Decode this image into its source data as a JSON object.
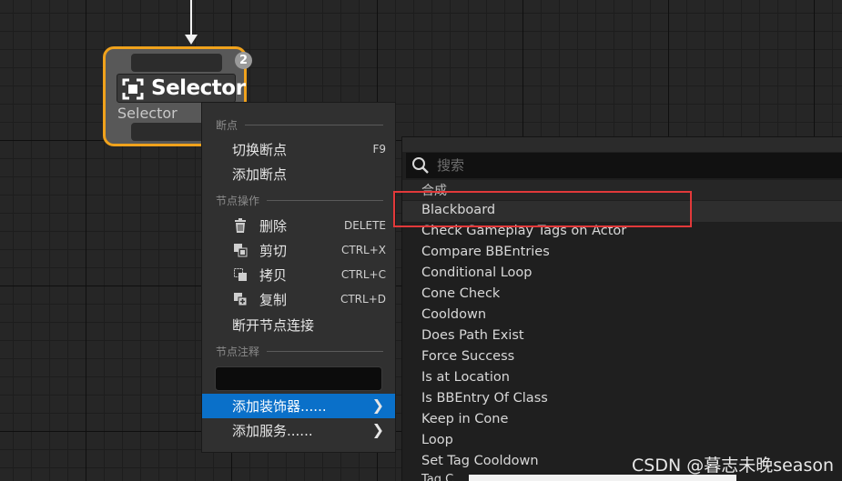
{
  "node": {
    "title": "Selector",
    "subtitle": "Selector",
    "badge": "2",
    "accent_color": "#f0a21c",
    "icon": "selector-icon"
  },
  "context_menu": {
    "section_breakpoints": "断点",
    "toggle_breakpoint": {
      "label": "切换断点",
      "shortcut": "F9"
    },
    "add_breakpoint": {
      "label": "添加断点"
    },
    "section_node_actions": "节点操作",
    "delete": {
      "label": "删除",
      "shortcut": "DELETE",
      "icon": "trash-icon"
    },
    "cut": {
      "label": "剪切",
      "shortcut": "CTRL+X",
      "icon": "cut-icon"
    },
    "copy": {
      "label": "拷贝",
      "shortcut": "CTRL+C",
      "icon": "copy-icon"
    },
    "duplicate": {
      "label": "复制",
      "shortcut": "CTRL+D",
      "icon": "duplicate-icon"
    },
    "break_links": {
      "label": "断开节点连接"
    },
    "section_comment": "节点注释",
    "comment_value": "",
    "add_decorator": {
      "label": "添加装饰器......",
      "selected": true
    },
    "add_service": {
      "label": "添加服务......"
    },
    "selected_color": "#0a70c9"
  },
  "decorator_menu": {
    "search_placeholder": "搜索",
    "category": "合成",
    "items": [
      "Blackboard",
      "Check Gameplay Tags on Actor",
      "Compare BBEntries",
      "Conditional Loop",
      "Cone Check",
      "Cooldown",
      "Does Path Exist",
      "Force Success",
      "Is at Location",
      "Is BBEntry Of Class",
      "Keep in Cone",
      "Loop",
      "Set Tag Cooldown"
    ],
    "partial_item": "Tag C",
    "highlighted": "Blackboard",
    "highlight_box_color": "#e2393a"
  },
  "watermark": "CSDN @暮志未晚season"
}
